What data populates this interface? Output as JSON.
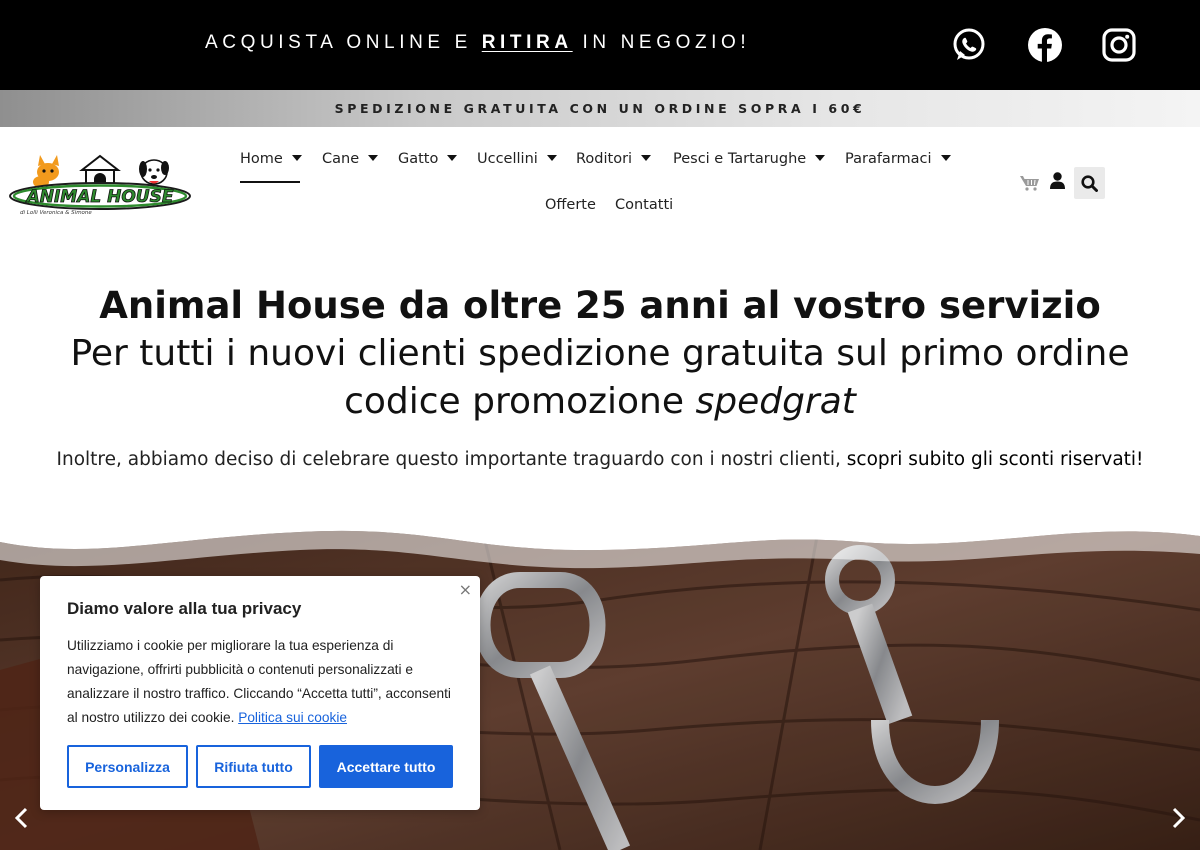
{
  "topbar": {
    "promo_prefix": "ACQUISTA ONLINE E ",
    "promo_emphasis": "RITIRA",
    "promo_suffix": " IN NEGOZIO!",
    "social": [
      "whatsapp-icon",
      "facebook-icon",
      "instagram-icon"
    ]
  },
  "shipping_banner": "SPEDIZIONE GRATUITA CON UN ORDINE SOPRA I 60€",
  "logo": {
    "name": "ANIMAL HOUSE",
    "tagline": "di Lolli Veronica & Simone"
  },
  "nav": {
    "items": [
      {
        "label": "Home",
        "has_dropdown": true,
        "active": true
      },
      {
        "label": "Cane",
        "has_dropdown": true
      },
      {
        "label": "Gatto",
        "has_dropdown": true
      },
      {
        "label": "Uccellini",
        "has_dropdown": true
      },
      {
        "label": "Roditori",
        "has_dropdown": true
      },
      {
        "label": "Pesci e Tartarughe",
        "has_dropdown": true
      },
      {
        "label": "Parafarmaci",
        "has_dropdown": true
      },
      {
        "label": "Offerte",
        "has_dropdown": false
      },
      {
        "label": "Contatti",
        "has_dropdown": false
      }
    ],
    "icons": [
      "cart-icon",
      "user-icon",
      "search-icon"
    ]
  },
  "hero": {
    "line1": "Animal House da oltre 25 anni al vostro servizio",
    "line2": "Per tutti i nuovi clienti spedizione gratuita sul primo ordine",
    "line3_prefix": "codice promozione ",
    "line3_code": "spedgrat",
    "subtitle_prefix": "Inoltre, abbiamo deciso di celebrare questo importante traguardo con i nostri clienti, ",
    "subtitle_link": "scopri subito gli sconti riservati!"
  },
  "cookie": {
    "title": "Diamo valore alla tua privacy",
    "body": "Utilizziamo i cookie per migliorare la tua esperienza di navigazione, offrirti pubblicità o contenuti personalizzati e analizzare il nostro traffico. Cliccando “Accetta tutti”, acconsenti al nostro utilizzo dei cookie. ",
    "policy_link": "Politica sui cookie",
    "close": "×",
    "buttons": {
      "customize": "Personalizza",
      "reject": "Rifiuta tutto",
      "accept": "Accettare tutto"
    }
  },
  "colors": {
    "primary_blue": "#1863dc",
    "topbar_bg": "#000000",
    "text": "#111111"
  }
}
